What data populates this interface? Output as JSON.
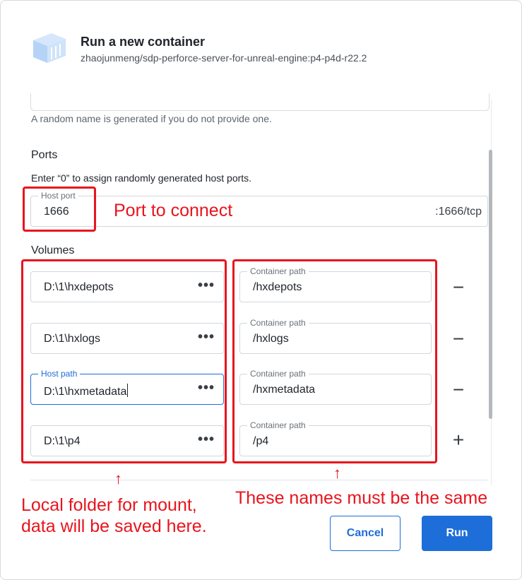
{
  "header": {
    "title": "Run a new container",
    "image": "zhaojunmeng/sdp-perforce-server-for-unreal-engine:p4-p4d-r22.2",
    "icon": "container-icon"
  },
  "name_hint": "A random name is generated if you do not provide one.",
  "ports": {
    "heading": "Ports",
    "hint": "Enter “0” to assign randomly generated host ports.",
    "host_port_label": "Host port",
    "host_port_value": "1666",
    "container_port": ":1666/tcp"
  },
  "volumes": {
    "heading": "Volumes",
    "rows": [
      {
        "host_value": "D:\\1\\hxdepots",
        "host_display": "D:\\1\\hxdepots",
        "container_label": "Container path",
        "container_value": "/hxdepots",
        "action": "−"
      },
      {
        "host_value": "D:\\1\\hxlogs",
        "host_display": "D:\\1\\hxlogs",
        "container_label": "Container path",
        "container_value": "/hxlogs",
        "action": "−"
      },
      {
        "host_label": "Host path",
        "host_value": "D:\\1\\hxmetadata",
        "container_label": "Container path",
        "container_value": "/hxmetadata",
        "action": "−"
      },
      {
        "host_value": "D:\\1\\p4",
        "host_display": "D:\\1\\p4",
        "container_label": "Container path",
        "container_value": "/p4",
        "action": "+"
      }
    ],
    "browse_glyph": "•••"
  },
  "buttons": {
    "cancel": "Cancel",
    "run": "Run"
  },
  "annotations": {
    "port": "Port to connect",
    "local_line1": "Local folder for mount,",
    "local_line2": "data will be saved here.",
    "same": "These names must be the same",
    "arrow": "↑"
  },
  "colors": {
    "accent": "#1d6ed8",
    "annotation": "#e8141d"
  }
}
